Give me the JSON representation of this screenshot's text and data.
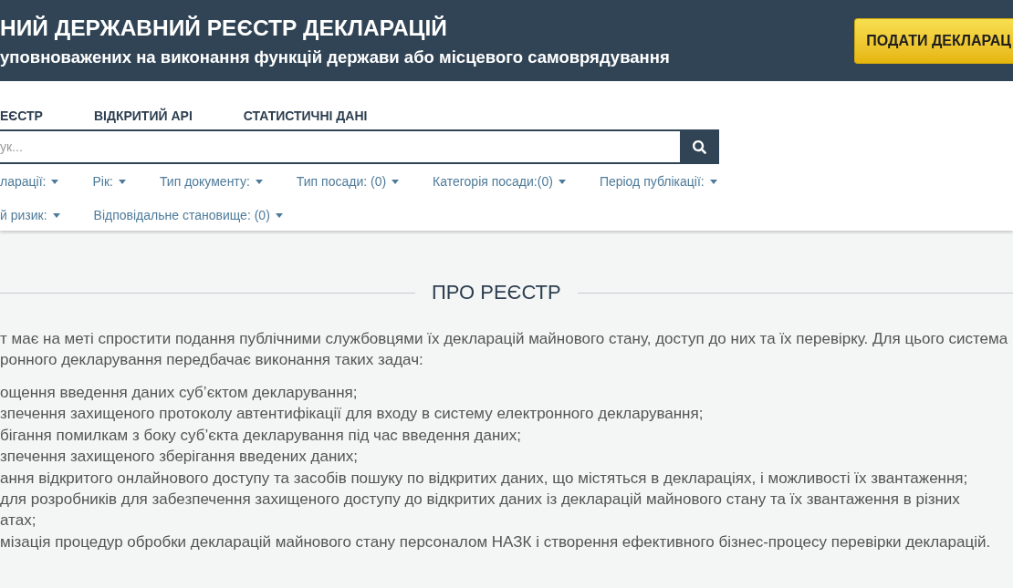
{
  "header": {
    "title": "НИЙ ДЕРЖАВНИЙ РЕЄСТР ДЕКЛАРАЦІЙ",
    "subtitle": "уповноважених на виконання функцій держави або місцевого самоврядування",
    "submit_button": "ПОДАТИ ДЕКЛАРАЦ"
  },
  "nav": [
    "ЕЄСТР",
    "ВІДКРИТИЙ API",
    "СТАТИСТИЧНІ ДАНІ"
  ],
  "search": {
    "placeholder": "ук..."
  },
  "filter_rows": [
    [
      "ларації:",
      "Рік:",
      "Тип документу:",
      "Тип посади: (0)",
      "Категорія посади:(0)",
      "Період публікації:"
    ],
    [
      "й ризик:",
      "Відповідальне становище: (0)"
    ]
  ],
  "about": {
    "heading": "ПРО РЕЄСТР",
    "intro_lines": [
      "т має на меті спростити подання публічними службовцями їх декларацій майнового стану, доступ до них та їх перевірку. Для цього система",
      "ронного декларування передбачає виконання таких задач:"
    ],
    "tasks": [
      {
        "lines": [
          "ощення введення даних суб’єктом декларування;"
        ]
      },
      {
        "lines": [
          "зпечення захищеного протоколу автентифікації для входу в систему електронного декларування;"
        ]
      },
      {
        "lines": [
          "бігання помилкам з боку суб’єкта декларування під час введення даних;"
        ]
      },
      {
        "lines": [
          "зпечення захищеного зберігання введених даних;"
        ]
      },
      {
        "lines": [
          "ання відкритого онлайнового доступу та засобів пошуку по відкритих даних, що містяться в деклараціях, і можливості їх звантаження;"
        ]
      },
      {
        "lines": [
          "для розробників для забезпечення захищеного доступу до відкритих даних із декларацій майнового стану та їх звантаження в різних",
          "атах;"
        ]
      },
      {
        "lines": [
          "мізація процедур обробки декларацій майнового стану персоналом НАЗК і створення ефективного бізнес-процесу перевірки декларацій."
        ]
      }
    ]
  }
}
